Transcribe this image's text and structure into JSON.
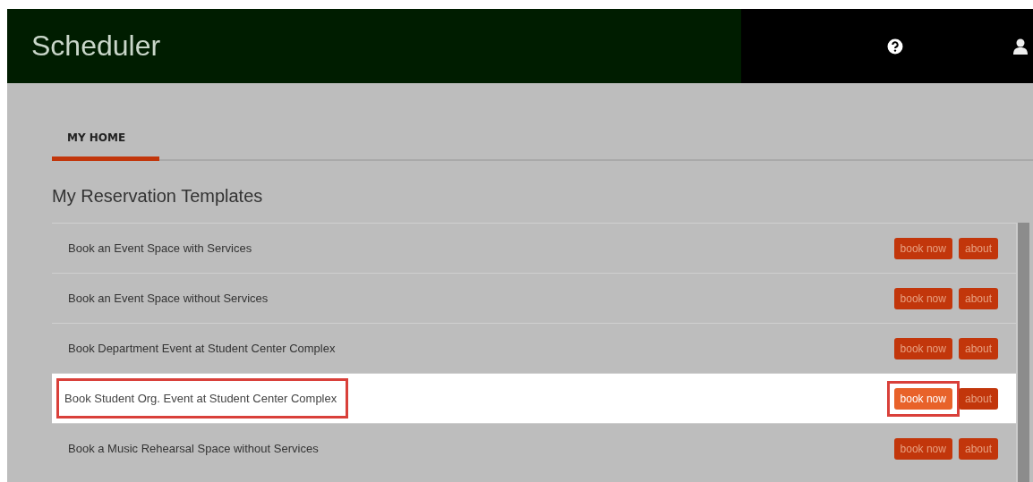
{
  "header": {
    "title": "Scheduler"
  },
  "tabs": [
    {
      "label": "MY HOME",
      "selected": true
    }
  ],
  "section": {
    "title": "My Reservation Templates"
  },
  "templates": [
    {
      "name": "Book an Event Space with Services",
      "book": "book now",
      "about": "about",
      "selected": false
    },
    {
      "name": "Book an Event Space without Services",
      "book": "book now",
      "about": "about",
      "selected": false
    },
    {
      "name": "Book Department Event at Student Center Complex",
      "book": "book now",
      "about": "about",
      "selected": false
    },
    {
      "name": "Book Student Org. Event at Student Center Complex",
      "book": "book now",
      "about": "about",
      "selected": true
    },
    {
      "name": "Book a Music Rehearsal Space without Services",
      "book": "book now",
      "about": "about",
      "selected": false
    }
  ]
}
